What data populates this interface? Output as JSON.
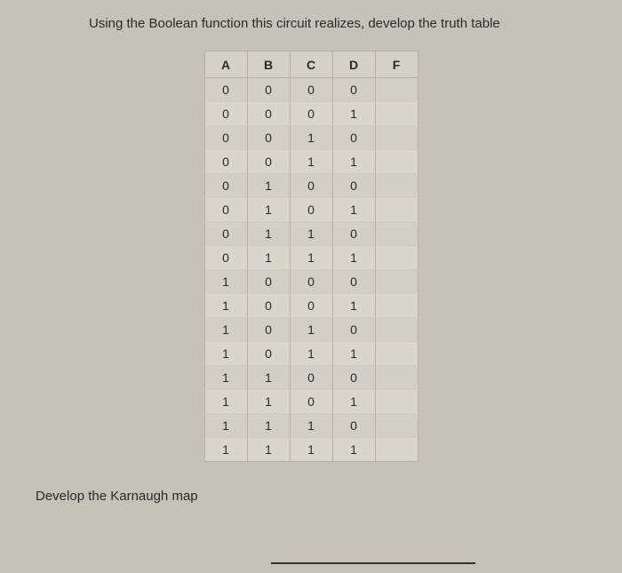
{
  "instruction_top": "Using the Boolean function this circuit realizes, develop the truth table",
  "instruction_bottom": "Develop the Karnaugh map",
  "table": {
    "headers": [
      "A",
      "B",
      "C",
      "D",
      "F"
    ],
    "rows": [
      [
        "0",
        "0",
        "0",
        "0",
        ""
      ],
      [
        "0",
        "0",
        "0",
        "1",
        ""
      ],
      [
        "0",
        "0",
        "1",
        "0",
        ""
      ],
      [
        "0",
        "0",
        "1",
        "1",
        ""
      ],
      [
        "0",
        "1",
        "0",
        "0",
        ""
      ],
      [
        "0",
        "1",
        "0",
        "1",
        ""
      ],
      [
        "0",
        "1",
        "1",
        "0",
        ""
      ],
      [
        "0",
        "1",
        "1",
        "1",
        ""
      ],
      [
        "1",
        "0",
        "0",
        "0",
        ""
      ],
      [
        "1",
        "0",
        "0",
        "1",
        ""
      ],
      [
        "1",
        "0",
        "1",
        "0",
        ""
      ],
      [
        "1",
        "0",
        "1",
        "1",
        ""
      ],
      [
        "1",
        "1",
        "0",
        "0",
        ""
      ],
      [
        "1",
        "1",
        "0",
        "1",
        ""
      ],
      [
        "1",
        "1",
        "1",
        "0",
        ""
      ],
      [
        "1",
        "1",
        "1",
        "1",
        ""
      ]
    ]
  }
}
